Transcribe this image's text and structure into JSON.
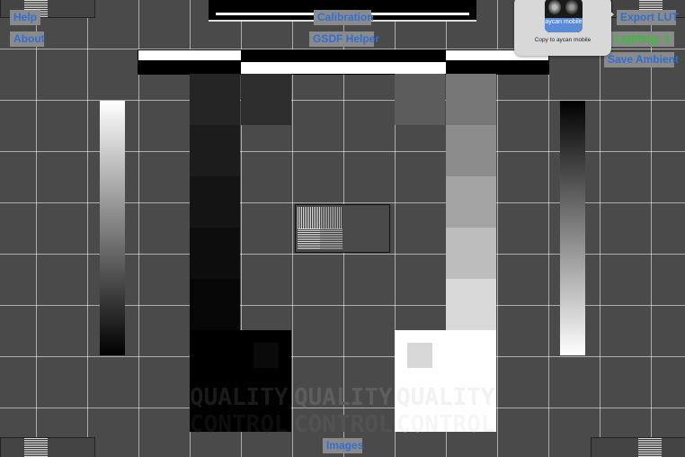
{
  "buttons": {
    "help": "Help",
    "about": "About",
    "calibration": "Calibration",
    "gsdf_helper": "GSDF Helper",
    "export_lut": "Export LUT",
    "lighting": "Lighting: 1",
    "save_ambient": "Save Ambient",
    "images": "Images"
  },
  "share_popup": {
    "app_label": "aycan mobile",
    "action_label": "Copy to aycan mobile"
  },
  "quality_text": {
    "line1": "QUALITY",
    "line2": "CONTROL"
  },
  "colors": {
    "background": "#4a4a4a",
    "grid_line": "#d9d9d9",
    "button_bg": "#8a8a8a",
    "button_text": "#2f6fd6",
    "status_green": "#2ec42e"
  }
}
